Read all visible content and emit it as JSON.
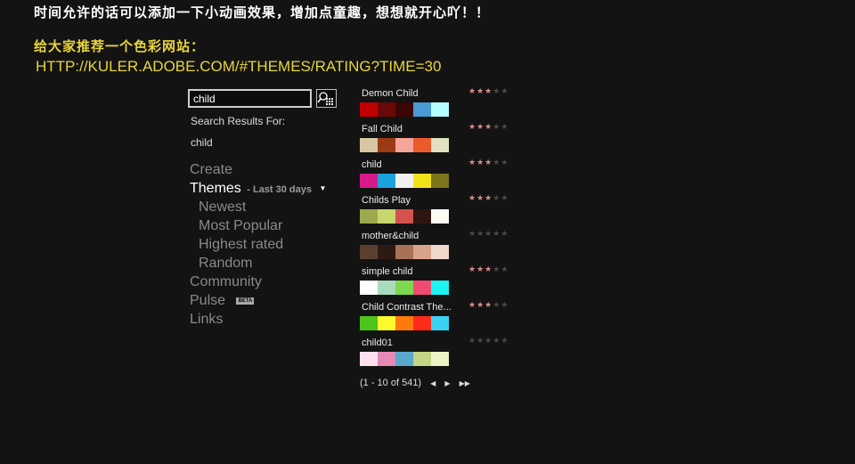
{
  "top_note": "时间允许的话可以添加一下小动画效果，增加点童趣，想想就开心吖！！",
  "recommend": {
    "title": "给大家推荐一个色彩网站：",
    "url": "HTTP://KULER.ADOBE.COM/#THEMES/RATING?TIME=30"
  },
  "search": {
    "value": "child",
    "results_label": "Search Results For:",
    "term": "child"
  },
  "nav": {
    "create": "Create",
    "themes": "Themes",
    "themes_filter": "- Last 30 days",
    "newest": "Newest",
    "most_popular": "Most Popular",
    "highest_rated": "Highest rated",
    "random": "Random",
    "community": "Community",
    "pulse": "Pulse",
    "beta": "BETA",
    "links": "Links"
  },
  "themes": [
    {
      "name": "Demon Child",
      "rating": 3,
      "colors": [
        "#c00000",
        "#6b0808",
        "#3a0606",
        "#4a9ad6",
        "#b4ffff"
      ]
    },
    {
      "name": "Fall Child",
      "rating": 3,
      "colors": [
        "#d7c8a2",
        "#9b3b16",
        "#f6a59a",
        "#ec5a2c",
        "#e2e0c2"
      ]
    },
    {
      "name": "child",
      "rating": 3,
      "colors": [
        "#d8198a",
        "#1aa2dc",
        "#f0f0f0",
        "#f2e21a",
        "#7d751c"
      ]
    },
    {
      "name": "Childs Play",
      "rating": 3,
      "colors": [
        "#9ea84c",
        "#c9d66e",
        "#d4524e",
        "#2e1510",
        "#fdfbf2"
      ]
    },
    {
      "name": "mother&child",
      "rating": 0,
      "colors": [
        "#5b4030",
        "#2e1a12",
        "#a87256",
        "#d7a48a",
        "#f0d8cc"
      ]
    },
    {
      "name": "simple child",
      "rating": 3,
      "colors": [
        "#ffffff",
        "#a8dcbc",
        "#7cd84e",
        "#f04c72",
        "#1cf4f4"
      ]
    },
    {
      "name": "Child Contrast The...",
      "rating": 3,
      "colors": [
        "#4cc41a",
        "#fafa2c",
        "#ff7a0c",
        "#ff2a1a",
        "#3ad2f2"
      ]
    },
    {
      "name": "child01",
      "rating": 0,
      "colors": [
        "#fce0ee",
        "#e48ab4",
        "#5aa8cc",
        "#c4d486",
        "#eaf4c4"
      ]
    }
  ],
  "pager": {
    "text": "(1 - 10 of 541)"
  },
  "colors": {
    "accent_yellow": "#e8d53a",
    "star_on": "#d98c8c",
    "background": "#131313"
  }
}
